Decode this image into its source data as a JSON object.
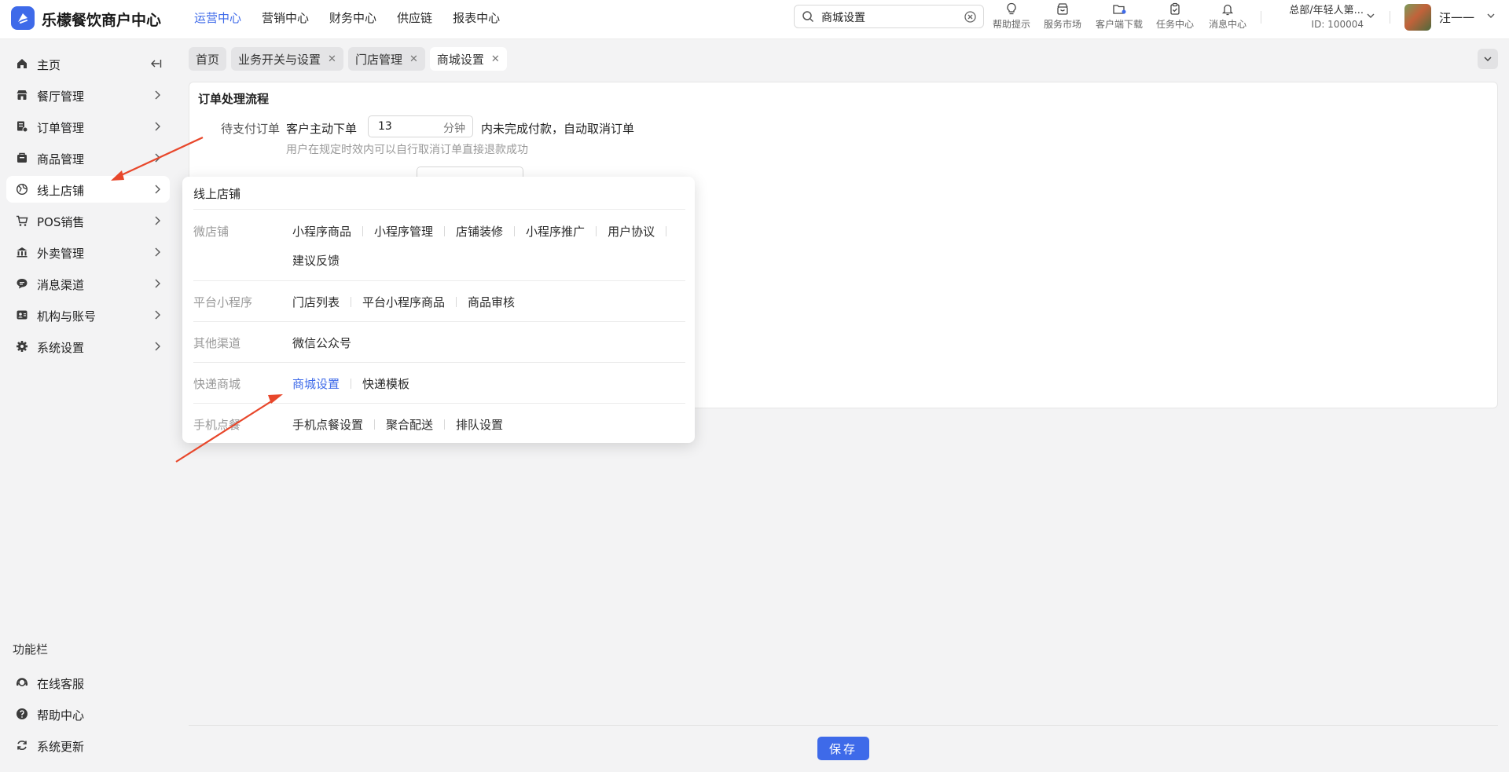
{
  "app": {
    "brand": "乐檬餐饮商户中心",
    "top_nav": [
      {
        "label": "运营中心",
        "active": true
      },
      {
        "label": "营销中心",
        "active": false
      },
      {
        "label": "财务中心",
        "active": false
      },
      {
        "label": "供应链",
        "active": false
      },
      {
        "label": "报表中心",
        "active": false
      }
    ],
    "search_value": "商城设置",
    "tools": [
      {
        "label": "帮助提示",
        "icon": "lightbulb-icon"
      },
      {
        "label": "服务市场",
        "icon": "store-icon"
      },
      {
        "label": "客户端下载",
        "icon": "download-folder-icon"
      },
      {
        "label": "任务中心",
        "icon": "clipboard-icon"
      },
      {
        "label": "消息中心",
        "icon": "bell-icon"
      }
    ],
    "org_name": "总部/年轻人第...",
    "org_id": "ID: 100004",
    "user_name": "汪一一"
  },
  "sidebar": {
    "items": [
      {
        "label": "主页",
        "icon": "home-icon"
      },
      {
        "label": "餐厅管理",
        "icon": "restaurant-icon"
      },
      {
        "label": "订单管理",
        "icon": "order-icon"
      },
      {
        "label": "商品管理",
        "icon": "goods-icon"
      },
      {
        "label": "线上店铺",
        "icon": "online-store-icon"
      },
      {
        "label": "POS销售",
        "icon": "pos-icon"
      },
      {
        "label": "外卖管理",
        "icon": "takeout-icon"
      },
      {
        "label": "消息渠道",
        "icon": "message-icon"
      },
      {
        "label": "机构与账号",
        "icon": "account-icon"
      },
      {
        "label": "系统设置",
        "icon": "settings-icon"
      }
    ],
    "func_title": "功能栏",
    "func_items": [
      {
        "label": "在线客服",
        "icon": "headset-icon"
      },
      {
        "label": "帮助中心",
        "icon": "help-icon"
      },
      {
        "label": "系统更新",
        "icon": "refresh-icon"
      }
    ]
  },
  "tabs": [
    {
      "label": "首页",
      "closable": false
    },
    {
      "label": "业务开关与设置",
      "closable": true
    },
    {
      "label": "门店管理",
      "closable": true
    },
    {
      "label": "商城设置",
      "closable": true
    }
  ],
  "content": {
    "section_title": "订单处理流程",
    "pending_label": "待支付订单",
    "pending_prefix": "客户主动下单",
    "pending_minutes": "13",
    "pending_unit": "分钟",
    "pending_suffix": "内未完成付款，自动取消订单",
    "pending_hint": "用户在规定时效内可以自行取消订单直接退款成功"
  },
  "save_label": "保存",
  "popover": {
    "title": "线上店铺",
    "groups": [
      {
        "label": "微店铺",
        "links": [
          "小程序商品",
          "小程序管理",
          "店铺装修",
          "小程序推广",
          "用户协议",
          "建议反馈"
        ]
      },
      {
        "label": "平台小程序",
        "links": [
          "门店列表",
          "平台小程序商品",
          "商品审核"
        ]
      },
      {
        "label": "其他渠道",
        "links": [
          "微信公众号"
        ]
      },
      {
        "label": "快递商城",
        "links": [
          "商城设置",
          "快递模板"
        ]
      },
      {
        "label": "手机点餐",
        "links": [
          "手机点餐设置",
          "聚合配送",
          "排队设置"
        ]
      }
    ]
  },
  "colors": {
    "accent": "#3e6ae9",
    "annotation_arrow": "#e8472b"
  }
}
